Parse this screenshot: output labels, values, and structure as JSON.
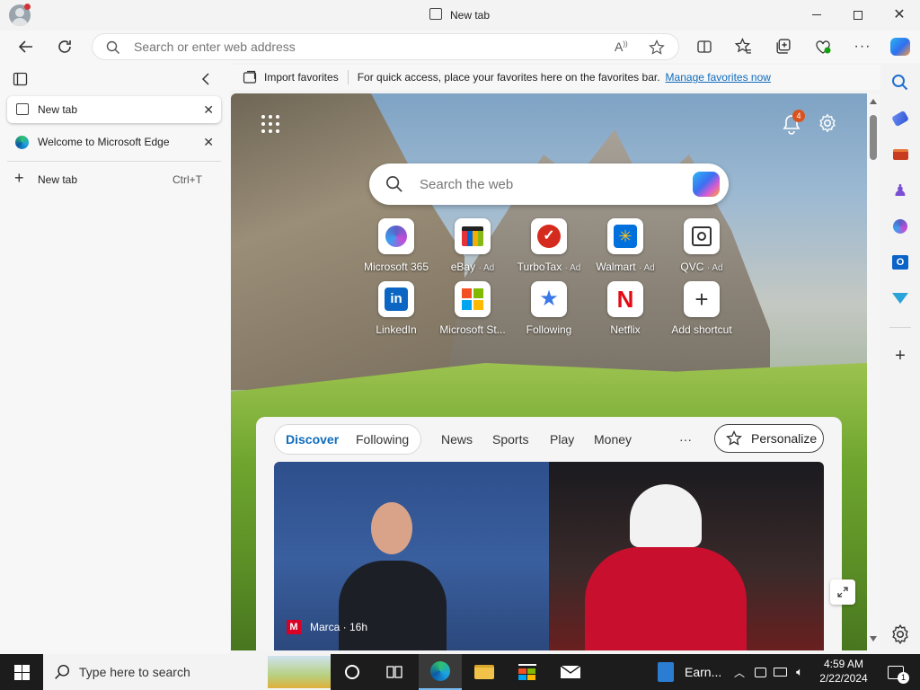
{
  "window": {
    "title": "New tab"
  },
  "toolbar": {
    "address_placeholder": "Search or enter web address"
  },
  "favorites_bar": {
    "import_label": "Import favorites",
    "message": "For quick access, place your favorites here on the favorites bar.",
    "manage_link": "Manage favorites now"
  },
  "tabs": [
    {
      "label": "New tab",
      "active": true
    },
    {
      "label": "Welcome to Microsoft Edge",
      "active": false
    }
  ],
  "new_tab": {
    "label": "New tab",
    "shortcut": "Ctrl+T"
  },
  "newtab_page": {
    "search_placeholder": "Search the web",
    "notification_count": "4",
    "shortcuts": [
      {
        "name": "Microsoft 365",
        "ad": ""
      },
      {
        "name": "eBay",
        "ad": "· Ad"
      },
      {
        "name": "TurboTax",
        "ad": "· Ad"
      },
      {
        "name": "Walmart",
        "ad": "· Ad"
      },
      {
        "name": "QVC",
        "ad": "· Ad"
      },
      {
        "name": "LinkedIn",
        "ad": ""
      },
      {
        "name": "Microsoft St...",
        "ad": ""
      },
      {
        "name": "Following",
        "ad": ""
      },
      {
        "name": "Netflix",
        "ad": ""
      },
      {
        "name": "Add shortcut",
        "ad": ""
      }
    ],
    "feed_tabs": [
      "Discover",
      "Following",
      "News",
      "Sports",
      "Play",
      "Money"
    ],
    "more_label": "···",
    "personalize_label": "Personalize",
    "article": {
      "source": "Marca · 16h"
    }
  },
  "taskbar": {
    "search_placeholder": "Type here to search",
    "pinned_app_label": "Earn...",
    "time": "4:59 AM",
    "date": "2/22/2024",
    "notification_count": "1"
  },
  "colors": {
    "accent": "#0f6cbd",
    "taskbar": "#1c1c1c"
  }
}
